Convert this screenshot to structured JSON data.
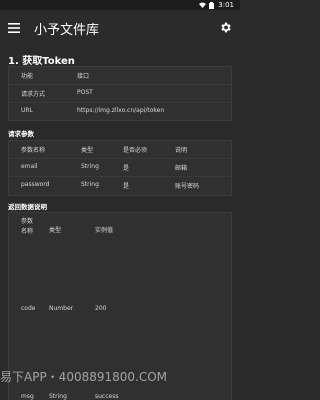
{
  "status": {
    "time": "3:01"
  },
  "appbar": {
    "title": "小予文件库"
  },
  "sections": {
    "main_title": "1. 获取Token",
    "request_params_title": "请求参数",
    "return_title": "返回数据说明"
  },
  "api_info": [
    {
      "label": "功能",
      "value": "接口"
    },
    {
      "label": "请求方式",
      "value": "POST"
    },
    {
      "label": "URL",
      "value": "https://img.zllxo.cn/api/token"
    }
  ],
  "request_params": {
    "headers": [
      "参数名称",
      "类型",
      "是否必须",
      "说明"
    ],
    "rows": [
      [
        "email",
        "String",
        "是",
        "邮箱"
      ],
      [
        "password",
        "String",
        "是",
        "账号密码"
      ]
    ]
  },
  "return_table": {
    "headers": [
      "参数名称",
      "类型",
      "实例值"
    ],
    "rows": [
      [
        "code",
        "Number",
        "200"
      ],
      [
        "msg",
        "String",
        "success"
      ]
    ]
  },
  "watermark": {
    "text": "易下APP・4008891800.COM"
  },
  "colors": {
    "background": "#2a2a2a",
    "card": "#303030",
    "text": "#e6e6e6"
  }
}
